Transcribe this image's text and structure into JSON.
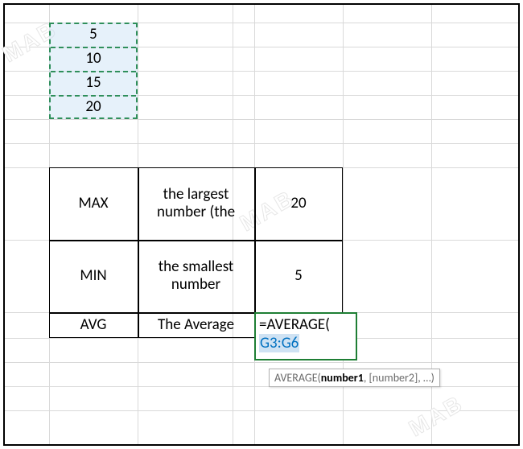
{
  "selection": {
    "values": [
      "5",
      "10",
      "15",
      "20"
    ]
  },
  "table": {
    "rows": [
      {
        "label": "MAX",
        "desc": "the largest number (the",
        "value": "20"
      },
      {
        "label": "MIN",
        "desc": "the smallest number",
        "value": "5"
      },
      {
        "label": "AVG",
        "desc": "The Average",
        "value": ""
      }
    ]
  },
  "formula": {
    "prefix": "=AVERAGE(",
    "range": "G3:G6"
  },
  "tooltip": {
    "fn": "AVERAGE(",
    "arg1": "number1",
    "rest": ", [number2], …)"
  },
  "watermark": "MAB"
}
